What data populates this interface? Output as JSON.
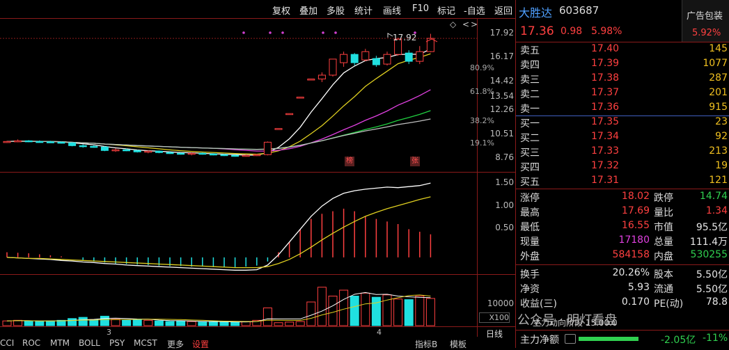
{
  "toolbar": {
    "items": [
      "复权",
      "叠加",
      "多股",
      "统计",
      "画线",
      "F10",
      "标记",
      "-自选",
      "返回"
    ]
  },
  "stock": {
    "name": "大胜达",
    "code": "603687",
    "price": "17.36",
    "change": "0.98",
    "pct": "5.98%"
  },
  "sector": {
    "name": "广告包装",
    "pct": "5.92%"
  },
  "asks": [
    {
      "label": "卖五",
      "price": "17.40",
      "vol": "145"
    },
    {
      "label": "卖四",
      "price": "17.39",
      "vol": "1077"
    },
    {
      "label": "卖三",
      "price": "17.38",
      "vol": "287"
    },
    {
      "label": "卖二",
      "price": "17.37",
      "vol": "201"
    },
    {
      "label": "卖一",
      "price": "17.36",
      "vol": "915"
    }
  ],
  "bids": [
    {
      "label": "买一",
      "price": "17.35",
      "vol": "23"
    },
    {
      "label": "买二",
      "price": "17.34",
      "vol": "92"
    },
    {
      "label": "买三",
      "price": "17.33",
      "vol": "213"
    },
    {
      "label": "买四",
      "price": "17.32",
      "vol": "19"
    },
    {
      "label": "买五",
      "price": "17.31",
      "vol": "121"
    }
  ],
  "stats": [
    {
      "l1": "涨停",
      "v1": "18.02",
      "c1": "red",
      "l2": "跌停",
      "v2": "14.74",
      "c2": "green"
    },
    {
      "l1": "最高",
      "v1": "17.69",
      "c1": "red",
      "l2": "量比",
      "v2": "1.34",
      "c2": "red"
    },
    {
      "l1": "最低",
      "v1": "16.55",
      "c1": "red",
      "l2": "市值",
      "v2": "95.5亿",
      "c2": "white"
    },
    {
      "l1": "现量",
      "v1": "17180",
      "c1": "magenta",
      "l2": "总量",
      "v2": "111.4万",
      "c2": "white"
    },
    {
      "l1": "外盘",
      "v1": "584158",
      "c1": "red",
      "l2": "内盘",
      "v2": "530255",
      "c2": "green"
    }
  ],
  "fundamentals": [
    {
      "l1": "换手",
      "v1": "20.26%",
      "l2": "股本",
      "v2": "5.50亿"
    },
    {
      "l1": "净资",
      "v1": "5.93",
      "l2": "流通",
      "v2": "5.50亿"
    },
    {
      "l1": "收益(三)",
      "v1": "0.170",
      "l2": "PE(动)",
      "v2": "78.8"
    }
  ],
  "main_force": {
    "label": "主力净额",
    "value": "-2.05亿",
    "pct": "-11%"
  },
  "watermark": "公众号 · 明灯看盘",
  "stage_text": "主力动向阶段 15.00.0",
  "price_axis": [
    "17.92",
    "16.17",
    "14.42",
    "13.54",
    "12.26",
    "10.51",
    "8.76"
  ],
  "pct_axis": [
    "80.9%",
    "61.8%",
    "38.2%",
    "19.1%"
  ],
  "macd_axis": [
    "1.50",
    "1.00",
    "0.50"
  ],
  "vol_axis": [
    "10000",
    "X100"
  ],
  "period_label": "日线",
  "high_marker": "17.92",
  "badges": [
    "榜",
    "张"
  ],
  "date_marks": [
    "3",
    "4"
  ],
  "bottom_tabs": [
    "CCI",
    "ROC",
    "MTM",
    "BOLL",
    "PSY",
    "MCST",
    "更多",
    "设置"
  ],
  "bottom_right": [
    "指标B",
    "模板"
  ],
  "colors": {
    "up": "#ff4040",
    "down": "#20e0e0",
    "ma5": "#ffffff",
    "ma10": "#e0d020",
    "ma20": "#e040e0",
    "ma30": "#20d040",
    "ma60": "#c0c0c0",
    "grid": "#8b1a1a"
  },
  "chart_data": {
    "type": "candlestick",
    "candles": [
      [
        9.85,
        9.95,
        9.8,
        9.9
      ],
      [
        9.9,
        10.05,
        9.85,
        9.95
      ],
      [
        9.95,
        10.0,
        9.85,
        9.9
      ],
      [
        9.9,
        9.98,
        9.82,
        9.88
      ],
      [
        9.88,
        9.95,
        9.8,
        9.85
      ],
      [
        9.85,
        9.92,
        9.75,
        9.8
      ],
      [
        9.8,
        9.85,
        9.55,
        9.6
      ],
      [
        9.6,
        9.7,
        9.45,
        9.55
      ],
      [
        9.55,
        9.65,
        9.45,
        9.5
      ],
      [
        9.5,
        9.55,
        9.2,
        9.25
      ],
      [
        9.25,
        9.4,
        9.15,
        9.3
      ],
      [
        9.3,
        9.4,
        9.2,
        9.25
      ],
      [
        9.25,
        9.3,
        9.1,
        9.15
      ],
      [
        9.15,
        9.25,
        9.05,
        9.2
      ],
      [
        9.2,
        9.25,
        9.05,
        9.1
      ],
      [
        9.1,
        9.2,
        9.0,
        9.05
      ],
      [
        9.05,
        9.1,
        8.95,
        9.0
      ],
      [
        9.0,
        9.1,
        8.9,
        9.05
      ],
      [
        9.05,
        9.1,
        8.95,
        9.0
      ],
      [
        9.0,
        9.05,
        8.9,
        8.95
      ],
      [
        8.95,
        9.0,
        8.85,
        8.9
      ],
      [
        8.9,
        8.95,
        8.8,
        8.85
      ],
      [
        8.85,
        8.95,
        8.8,
        8.9
      ],
      [
        8.9,
        9.0,
        8.85,
        8.95
      ],
      [
        8.95,
        9.9,
        8.9,
        9.85
      ],
      [
        10.84,
        10.84,
        10.84,
        10.84
      ],
      [
        11.92,
        11.92,
        11.92,
        11.92
      ],
      [
        13.11,
        13.11,
        13.11,
        13.11
      ],
      [
        14.42,
        14.42,
        14.42,
        14.42
      ],
      [
        14.42,
        14.9,
        14.2,
        14.7
      ],
      [
        14.7,
        15.86,
        14.6,
        15.86
      ],
      [
        15.6,
        16.4,
        15.3,
        16.2
      ],
      [
        16.2,
        16.3,
        15.4,
        15.6
      ],
      [
        15.8,
        16.6,
        15.7,
        16.4
      ],
      [
        15.9,
        16.1,
        15.3,
        15.45
      ],
      [
        15.5,
        16.4,
        15.4,
        16.2
      ],
      [
        16.2,
        17.4,
        16.1,
        17.3
      ],
      [
        16.3,
        16.5,
        15.5,
        15.7
      ],
      [
        15.7,
        16.8,
        15.5,
        16.4
      ],
      [
        16.4,
        17.69,
        16.35,
        17.36
      ]
    ],
    "price_range": [
      8.76,
      17.92
    ],
    "macd": [
      0.1,
      0.09,
      0.08,
      0.06,
      0.04,
      0.02,
      0.0,
      -0.05,
      -0.08,
      -0.1,
      -0.12,
      -0.13,
      -0.14,
      -0.15,
      -0.16,
      -0.17,
      -0.17,
      -0.18,
      -0.18,
      -0.19,
      -0.19,
      -0.19,
      -0.18,
      -0.16,
      -0.08,
      0.1,
      0.3,
      0.55,
      0.75,
      0.85,
      0.9,
      0.95,
      0.9,
      0.8,
      0.75,
      0.7,
      0.65,
      0.55,
      0.5,
      0.45
    ],
    "dif": [
      0.0,
      -0.01,
      -0.02,
      -0.03,
      -0.04,
      -0.06,
      -0.07,
      -0.09,
      -0.1,
      -0.12,
      -0.13,
      -0.15,
      -0.16,
      -0.17,
      -0.18,
      -0.19,
      -0.2,
      -0.21,
      -0.22,
      -0.23,
      -0.24,
      -0.25,
      -0.25,
      -0.24,
      -0.15,
      0.05,
      0.3,
      0.55,
      0.8,
      1.0,
      1.15,
      1.25,
      1.3,
      1.33,
      1.35,
      1.37,
      1.36,
      1.38,
      1.4,
      1.45
    ],
    "dea": [
      0.0,
      -0.01,
      -0.02,
      -0.02,
      -0.03,
      -0.04,
      -0.05,
      -0.06,
      -0.07,
      -0.08,
      -0.09,
      -0.1,
      -0.11,
      -0.12,
      -0.13,
      -0.14,
      -0.15,
      -0.16,
      -0.17,
      -0.18,
      -0.19,
      -0.2,
      -0.2,
      -0.2,
      -0.18,
      -0.12,
      -0.04,
      0.07,
      0.2,
      0.34,
      0.47,
      0.59,
      0.7,
      0.8,
      0.88,
      0.95,
      1.01,
      1.07,
      1.13,
      1.18
    ],
    "macd_range": [
      -0.3,
      1.6
    ],
    "volume": [
      8,
      9,
      8,
      7,
      8,
      9,
      12,
      14,
      10,
      16,
      11,
      9,
      10,
      9,
      8,
      7,
      8,
      7,
      6,
      7,
      6,
      6,
      7,
      9,
      30,
      5,
      6,
      7,
      40,
      65,
      50,
      60,
      50,
      55,
      48,
      52,
      45,
      44,
      50,
      46
    ],
    "volume_up": [
      1,
      1,
      0,
      0,
      0,
      0,
      0,
      0,
      0,
      0,
      1,
      0,
      0,
      1,
      0,
      0,
      0,
      1,
      0,
      0,
      0,
      0,
      1,
      1,
      1,
      1,
      1,
      1,
      1,
      1,
      1,
      1,
      0,
      1,
      0,
      1,
      1,
      0,
      1,
      1
    ],
    "volume_range": [
      0,
      80
    ]
  }
}
